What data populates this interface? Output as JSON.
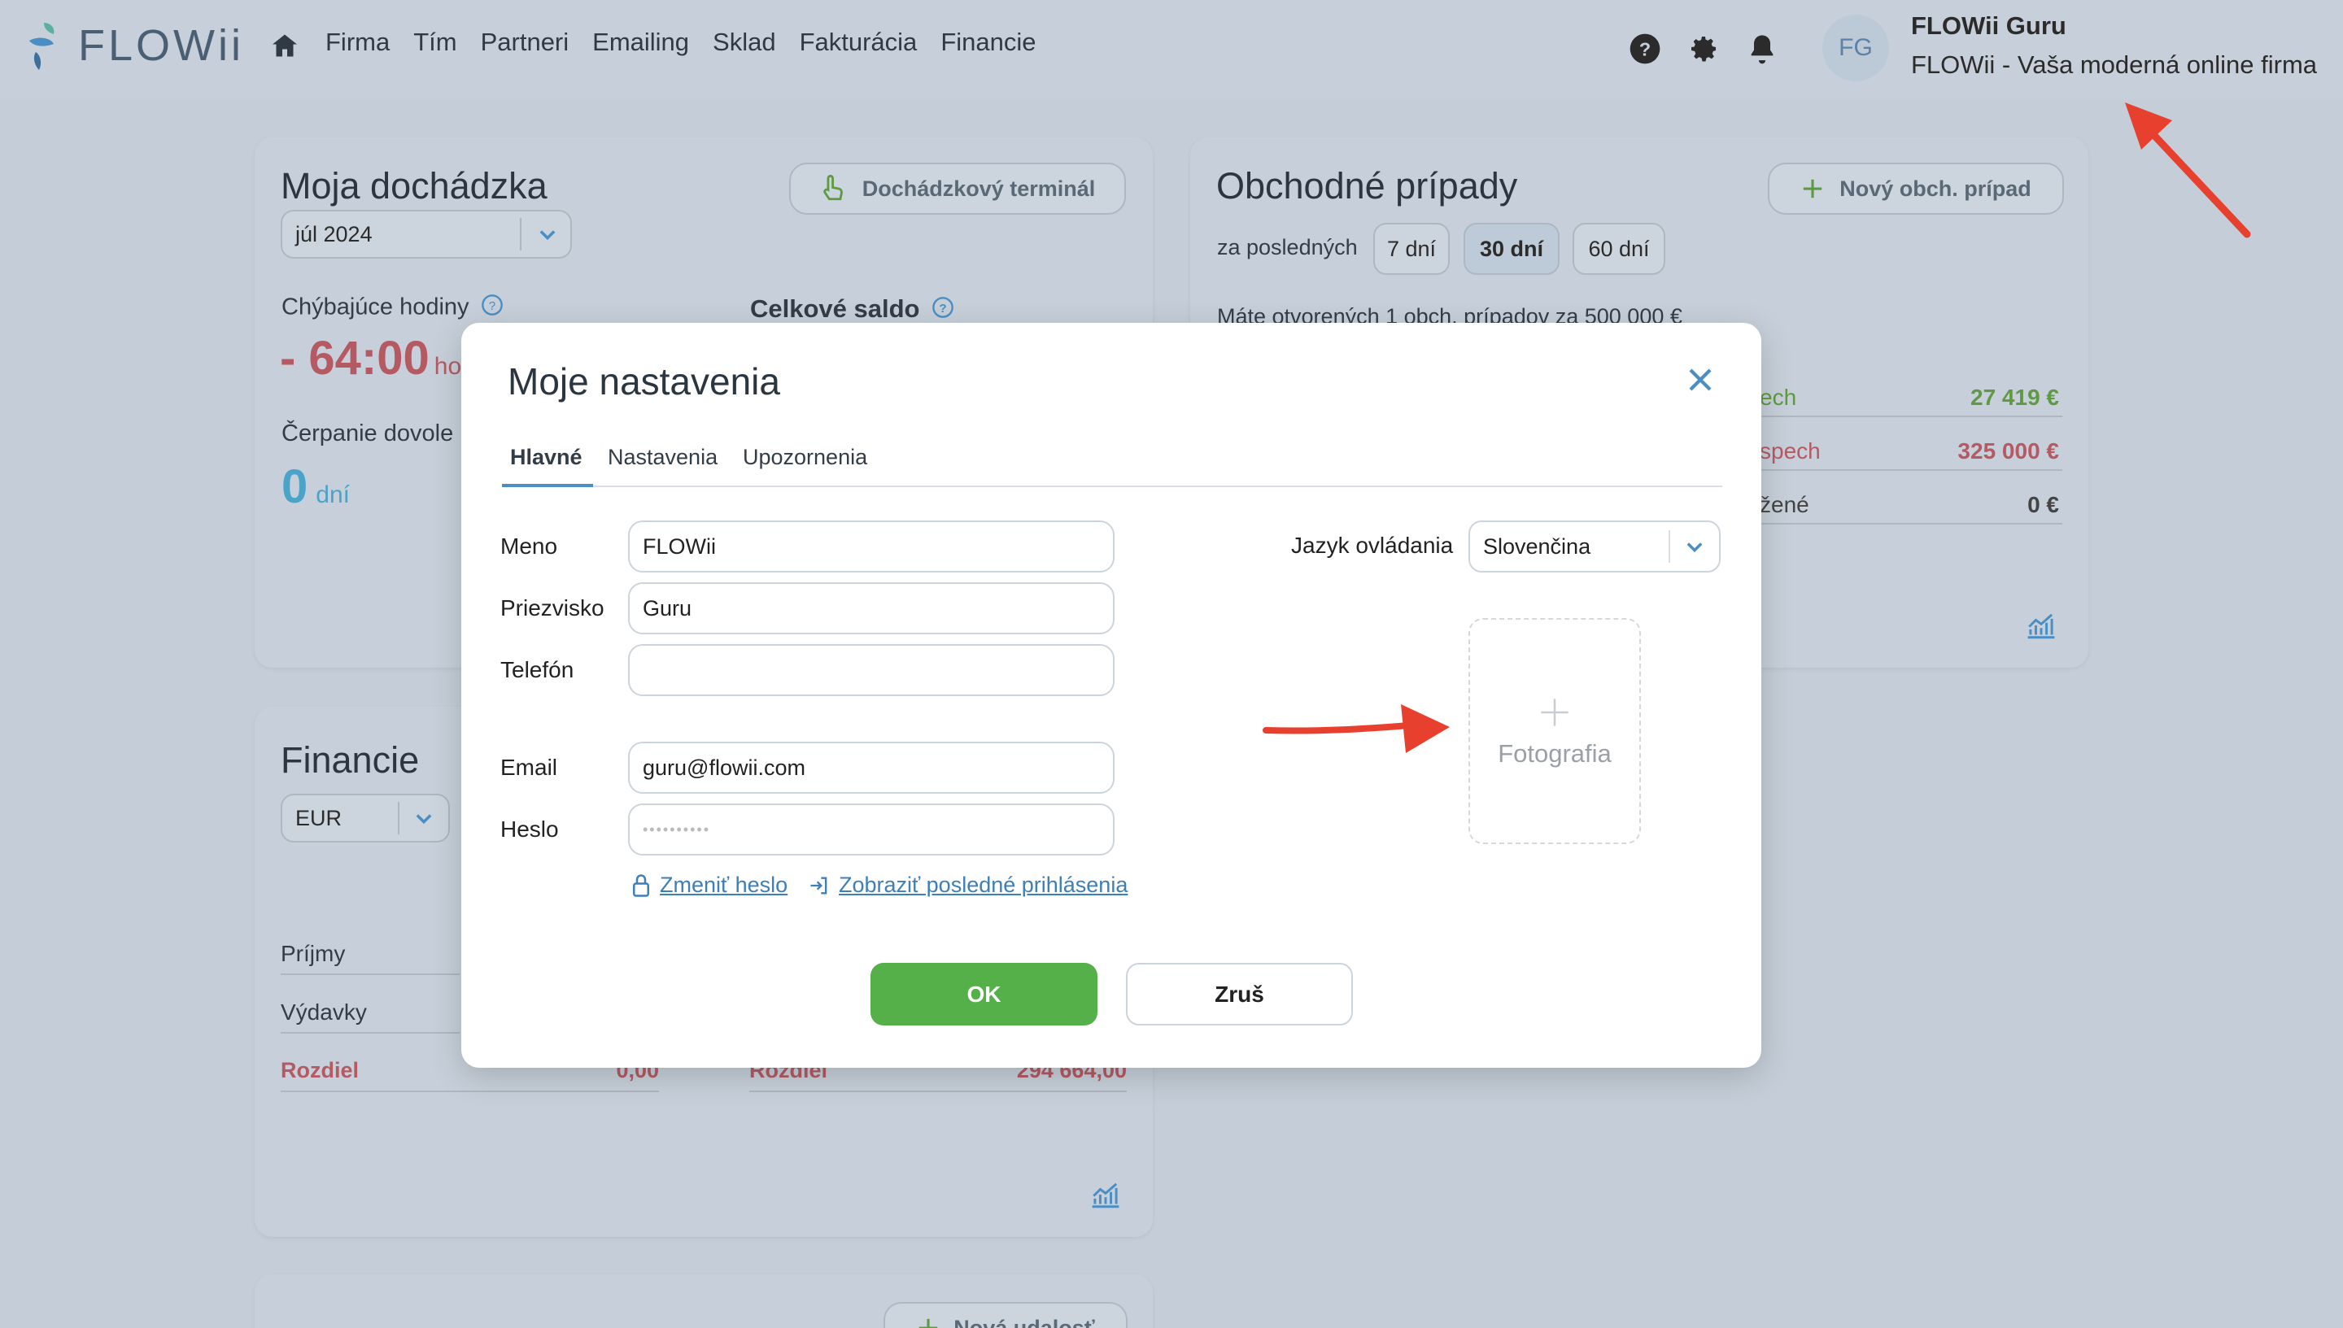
{
  "app": {
    "logo_text": "FLOWii"
  },
  "nav": {
    "items": [
      {
        "label": "Firma"
      },
      {
        "label": "Tím"
      },
      {
        "label": "Partneri"
      },
      {
        "label": "Emailing"
      },
      {
        "label": "Sklad"
      },
      {
        "label": "Fakturácia"
      },
      {
        "label": "Financie"
      }
    ]
  },
  "user": {
    "initials": "FG",
    "name": "FLOWii Guru",
    "company": "FLOWii - Vaša moderná online firma"
  },
  "attendance": {
    "title": "Moja dochádzka",
    "terminal_button": "Dochádzkový terminál",
    "month": "júl 2024",
    "missing_hours_label": "Chýbajúce hodiny",
    "missing_hours_value": "- 64:00",
    "missing_hours_unit": "ho",
    "balance_label": "Celkové saldo",
    "vacation_label": "Čerpanie dovole",
    "vacation_value": "0",
    "vacation_unit": "dní"
  },
  "deals": {
    "title": "Obchodné prípady",
    "new_button": "Nový obch. prípad",
    "period_label": "za posledných",
    "periods": [
      "7 dní",
      "30 dní",
      "60 dní"
    ],
    "active_period": "30 dní",
    "summary": "Máte otvorených 1 obch. prípadov za 500 000 €",
    "rows": [
      {
        "label": "ech",
        "value": "27 419 €",
        "tone": "green"
      },
      {
        "label": "spech",
        "value": "325 000 €",
        "tone": "red"
      },
      {
        "label": "žené",
        "value": "0 €",
        "tone": "dark"
      }
    ]
  },
  "finance": {
    "title": "Financie",
    "currency": "EUR",
    "rows": [
      {
        "label": "Príjmy"
      },
      {
        "label": "Výdavky"
      }
    ],
    "diff_label": "Rozdiel",
    "diff_left": "0,00",
    "diff_right_label": "Rozdiel",
    "diff_right": "294 664,00"
  },
  "events": {
    "new_button": "Nová udalosť"
  },
  "dialog": {
    "title": "Moje nastavenia",
    "tabs": [
      {
        "label": "Hlavné",
        "active": true
      },
      {
        "label": "Nastavenia",
        "active": false
      },
      {
        "label": "Upozornenia",
        "active": false
      }
    ],
    "fields": {
      "first_name": {
        "label": "Meno",
        "value": "FLOWii"
      },
      "last_name": {
        "label": "Priezvisko",
        "value": "Guru"
      },
      "phone": {
        "label": "Telefón",
        "value": ""
      },
      "email": {
        "label": "Email",
        "value": "guru@flowii.com"
      },
      "password": {
        "label": "Heslo",
        "value": "••••••••••"
      }
    },
    "change_password_link": "Zmeniť heslo",
    "last_logins_link": "Zobraziť posledné prihlásenia",
    "language_label": "Jazyk ovládania",
    "language_value": "Slovenčina",
    "photo_label": "Fotografia",
    "ok_button": "OK",
    "cancel_button": "Zruš"
  },
  "colors": {
    "accent_blue": "#4a8ec4",
    "ok_green": "#55b04a",
    "annotation_red": "#e8402f",
    "negative_red": "#b55a63",
    "positive_green": "#5f9a43"
  }
}
